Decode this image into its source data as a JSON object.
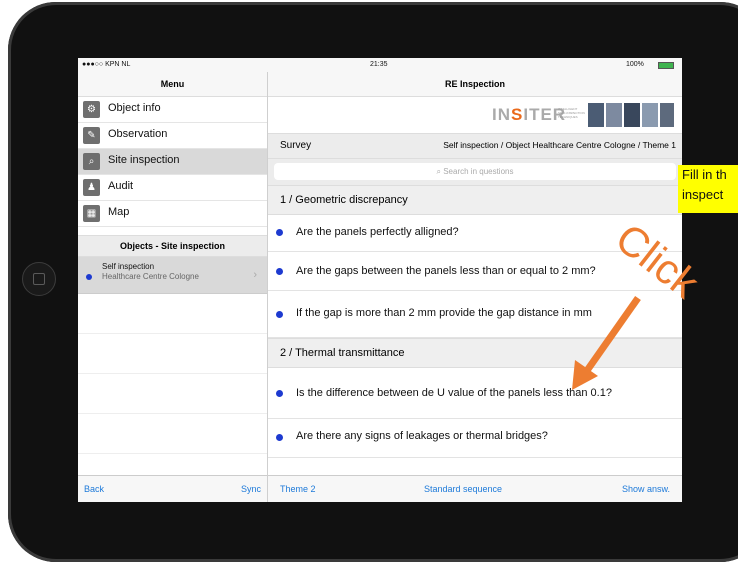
{
  "status_bar": {
    "carrier": "●●●○○ KPN NL",
    "time": "21:35",
    "battery": "100%"
  },
  "menu": {
    "title": "Menu",
    "items": [
      {
        "label": "Object info",
        "icon": "object-info-icon"
      },
      {
        "label": "Observation",
        "icon": "pencil-icon"
      },
      {
        "label": "Site inspection",
        "icon": "magnifier-icon"
      },
      {
        "label": "Audit",
        "icon": "audit-icon"
      },
      {
        "label": "Map",
        "icon": "map-icon"
      }
    ],
    "objects_header": "Objects - Site inspection",
    "object": {
      "title": "Self inspection",
      "subtitle": "Healthcare Centre Cologne"
    },
    "back": "Back",
    "sync": "Sync"
  },
  "main": {
    "title": "RE Inspection",
    "logo": {
      "prefix": "IN",
      "accent": "S",
      "rest": "ITER",
      "tagline": "INTELLIGENT SELF-INSPECTION TECHNIQUES"
    },
    "survey_label": "Survey",
    "survey_path": "Self inspection / Object Healthcare Centre Cologne / Theme 1",
    "search_placeholder": "Search in questions",
    "sections": [
      {
        "title": "1 / Geometric discrepancy",
        "questions": [
          "Are the panels perfectly alligned?",
          "Are the gaps between the panels less  than or equal to 2 mm?",
          "If the gap is more than 2 mm provide the gap distance in mm"
        ]
      },
      {
        "title": "2 / Thermal transmittance",
        "questions": [
          "Is the difference between de U value of the panels less than 0.1?",
          "Are there any signs of leakages or thermal bridges?"
        ]
      }
    ],
    "bottom": {
      "theme": "Theme 2",
      "sequence": "Standard sequence",
      "show": "Show answ."
    }
  },
  "annotation": {
    "callout_line1": "Fill in th",
    "callout_line2": "inspect",
    "click_text": "Click",
    "accent_color": "#ed7d31"
  }
}
